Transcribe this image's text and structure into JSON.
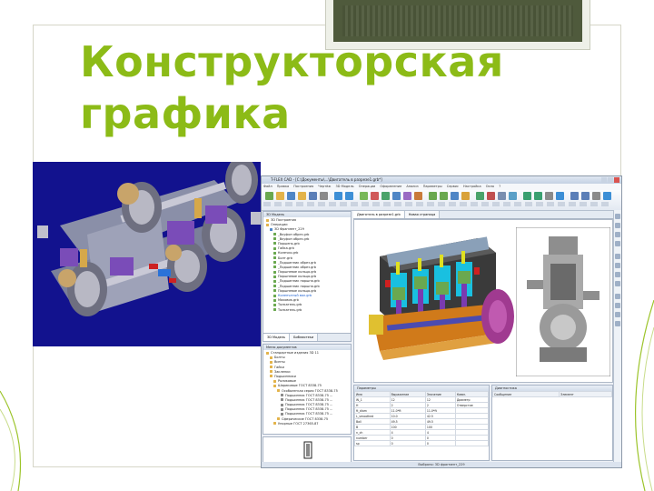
{
  "slide": {
    "title_line1": "Конструкторская",
    "title_line2": "графика",
    "colors": {
      "title": "#8cbb17",
      "frame_border": "#d6d6c8",
      "render_bg": "#12128e"
    }
  },
  "cad": {
    "window_title": "T-FLEX CAD - [C:\\Документы\\...\\Двигатель в разрезе1.grb*]",
    "menu": [
      "Файл",
      "Правка",
      "Построения",
      "Чертёж",
      "3D Модель",
      "Операции",
      "Оформление",
      "Анализ",
      "Параметры",
      "Сервис",
      "Настройка",
      "Окно",
      "?"
    ],
    "model_panel_title": "3D Модель",
    "model_tree": [
      "3D Построения",
      "Операции",
      "3D Фрагмент_229",
      "_Вкуфон обрез.grb",
      "_Вкуфон обрез.grb",
      "Поршень.grb",
      "Гайка.grb",
      "Колечко.grb",
      "Болт.grb",
      "_Подшипник обрез.grb",
      "_Подшипник обрез.grb",
      "Поршневое кольцо.grb",
      "Поршневое кольцо.grb",
      "_Подшипник поршня.grb",
      "_Подшипник поршня.grb",
      "Поршневое кольцо.grb",
      "Коленчатый вал.grb",
      "Маховик.grb",
      "Толкатель.grb",
      "Толкатель.grb"
    ],
    "docs_panel_title": "Меню документов",
    "docs_tree": [
      "Стандартные изделия 3D 11",
      "Болты",
      "Винты",
      "Гайки",
      "Заклепки",
      "Подшипники",
      "Роликовые",
      "Шариковые ГОСТ 8338-75",
      "Особолегкая серия ГОСТ 8338-75",
      "Подшипник ГОСТ 8338-75 ...",
      "Подшипник ГОСТ 8338-75 ...",
      "Подшипник ГОСТ 8338-75 ...",
      "Подшипник ГОСТ 8338-75 ...",
      "Подшипник ГОСТ 8338-75 ...",
      "Сферические ГОСТ 8338-75",
      "Упорные ГОСТ 27365-87"
    ],
    "doc_tabs": [
      "Двигатель в разрезе1.grb",
      "Новая страница"
    ],
    "bottom_tabs": [
      "3D Модель",
      "Библиотеки"
    ],
    "props_panel_title": "Параметры",
    "props_columns": [
      "Имя",
      "Выражение",
      "Значение",
      "Комм."
    ],
    "props_rows": [
      [
        "W_1",
        "12",
        "12",
        "Диаметр"
      ],
      [
        "H",
        "2",
        "2",
        "Отверстие"
      ],
      [
        "ft_diam",
        "11.0*ft",
        "11.0*ft",
        ""
      ],
      [
        "L_smoothed",
        "10.0",
        "42.5",
        ""
      ],
      [
        "Ball",
        "49.5",
        "49.5",
        ""
      ],
      [
        "B",
        "100",
        "100",
        ""
      ],
      [
        "n_ch",
        "4",
        "4",
        ""
      ],
      [
        "number",
        "0",
        "0",
        ""
      ],
      [
        "sp",
        "0",
        "0",
        ""
      ]
    ],
    "dialog_panel_title": "Диагностика",
    "dialog_columns": [
      "Сообщение",
      "Элемент"
    ],
    "status_text": "Выбрано: 3D фрагмент_229"
  }
}
